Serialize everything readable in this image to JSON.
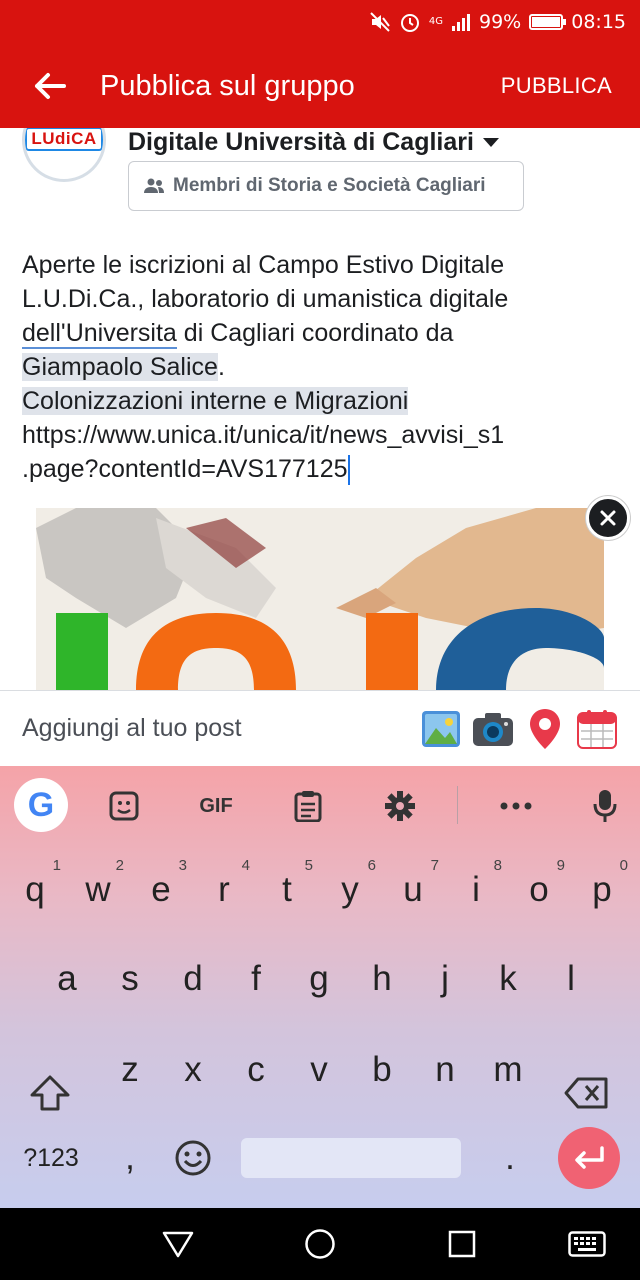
{
  "statusbar": {
    "network": "4G",
    "battery": "99%",
    "battery_level": 0.99,
    "time": "08:15"
  },
  "appbar": {
    "title": "Pubblica sul gruppo",
    "action": "PUBBLICA"
  },
  "composer": {
    "avatar_text": "LUdiCA",
    "group_name": "Digitale Università di Cagliari",
    "audience": "Membri di Storia e Società Cagliari",
    "lines": [
      "Aperte le iscrizioni al Campo Estivo Digitale",
      "L.U.Di.Ca., laboratorio di umanistica digitale",
      "dell'Universita",
      " di Cagliari coordinato da",
      "Giampaolo Salice",
      ".",
      "Colonizzazioni interne e Migrazioni",
      "https://www.unica.it/unica/it/news_avvisi_s1",
      ".page?contentId=AVS177125"
    ]
  },
  "addbar": {
    "label": "Aggiungi al tuo post",
    "tools": [
      "photo-icon",
      "camera-icon",
      "location-pin-icon",
      "calendar-icon"
    ]
  },
  "keyboard": {
    "google_letter": "G",
    "gif_label": "GIF",
    "row1": [
      "q",
      "w",
      "e",
      "r",
      "t",
      "y",
      "u",
      "i",
      "o",
      "p"
    ],
    "row1_hints": [
      "1",
      "2",
      "3",
      "4",
      "5",
      "6",
      "7",
      "8",
      "9",
      "0"
    ],
    "row2": [
      "a",
      "s",
      "d",
      "f",
      "g",
      "h",
      "j",
      "k",
      "l"
    ],
    "row3": [
      "z",
      "x",
      "c",
      "v",
      "b",
      "n",
      "m"
    ],
    "symbols_label": "?123",
    "comma": ",",
    "period": "."
  },
  "colors": {
    "brand_red": "#d8130f",
    "enter_key": "#f06273"
  }
}
